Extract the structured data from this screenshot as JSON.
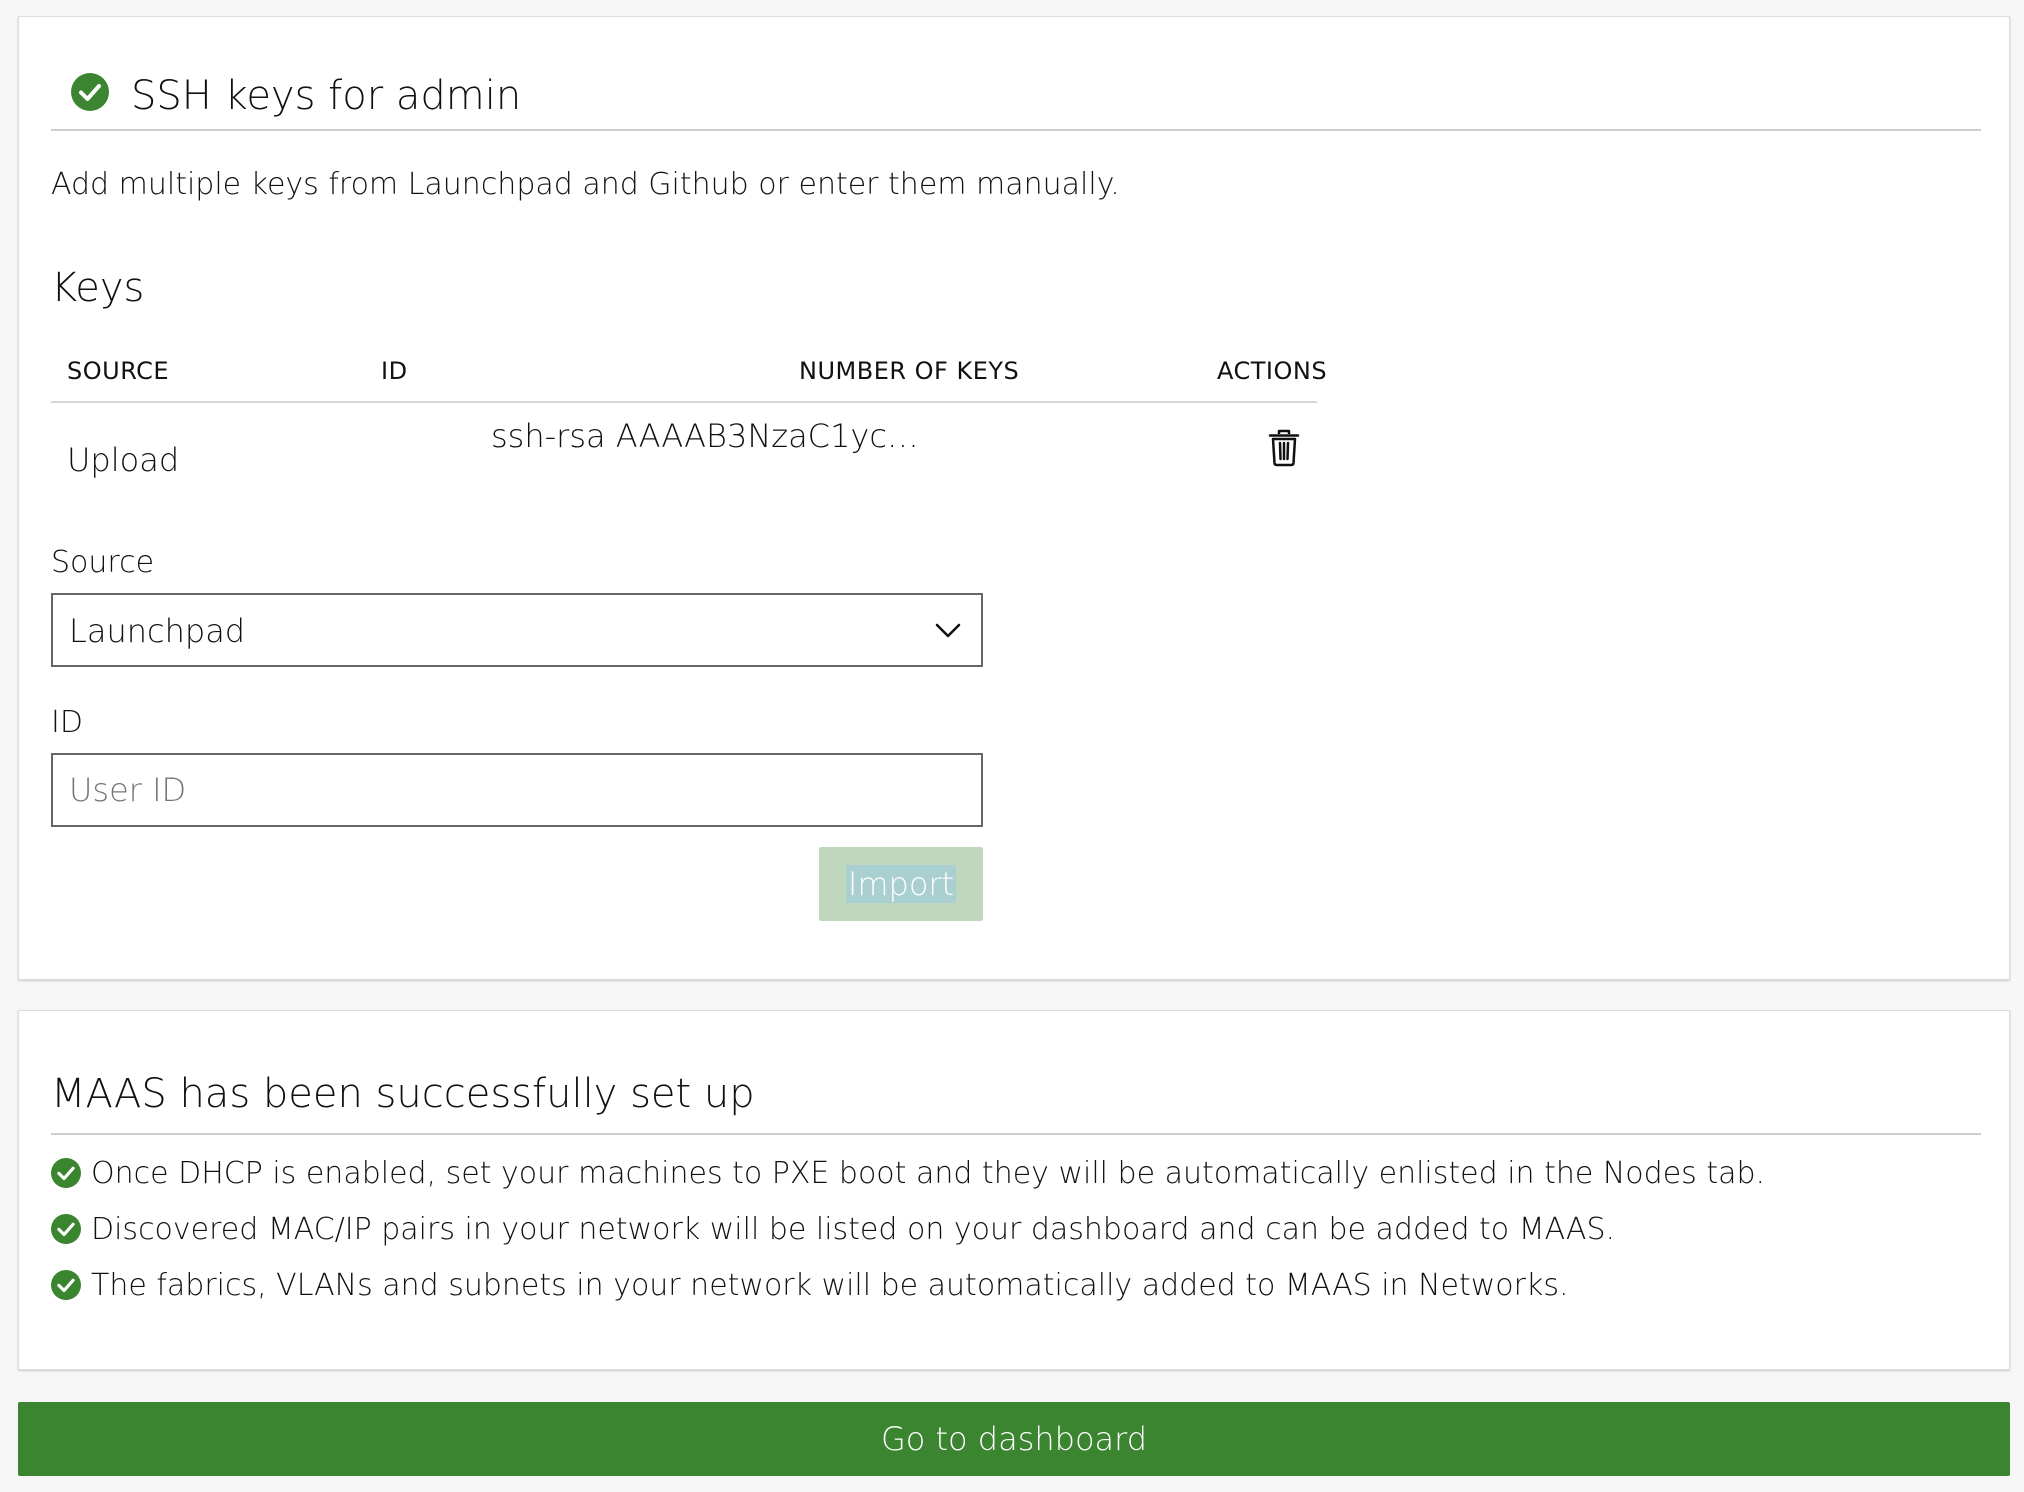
{
  "ssh_card": {
    "title": "SSH keys for admin",
    "description": "Add multiple keys from Launchpad and Github or enter them manually.",
    "keys_heading": "Keys",
    "table": {
      "headers": [
        "SOURCE",
        "ID",
        "NUMBER OF KEYS",
        "ACTIONS"
      ],
      "rows": [
        {
          "source": "Upload",
          "id": "",
          "number_of_keys": "ssh-rsa AAAAB3NzaC1yc…",
          "action_icon": "trash-icon"
        }
      ]
    },
    "source_label": "Source",
    "source_selected": "Launchpad",
    "id_label": "ID",
    "id_placeholder": "User ID",
    "id_value": "",
    "import_label": "Import"
  },
  "success_card": {
    "title": "MAAS has been successfully set up",
    "items": [
      "Once DHCP is enabled, set your machines to PXE boot and they will be automatically enlisted in the Nodes tab.",
      "Discovered MAC/IP pairs in your network will be listed on your dashboard and can be added to MAAS.",
      "The fabrics, VLANs and subnets in your network will be automatically added to MAAS in Networks."
    ]
  },
  "dashboard_button_label": "Go to dashboard",
  "colors": {
    "success_green": "#3b8531",
    "check_green": "#3b8531",
    "import_disabled": "#bfd8bd",
    "border": "#666666",
    "background": "#f7f7f7"
  }
}
